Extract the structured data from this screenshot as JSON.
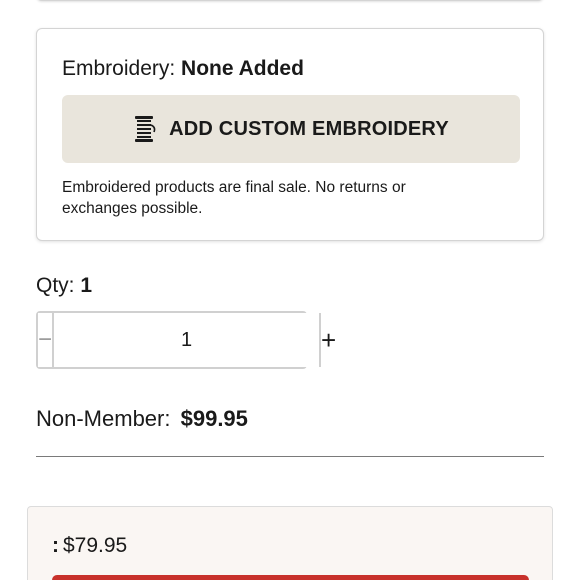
{
  "embroidery": {
    "label": "Embroidery:",
    "value": "None Added",
    "button_label": "ADD CUSTOM EMBROIDERY",
    "button_icon": "thread-spool-icon",
    "note": "Embroidered products are final sale. No returns or exchanges possible."
  },
  "quantity": {
    "label": "Qty:",
    "value": "1",
    "input_value": "1",
    "decrement_symbol": "−",
    "increment_symbol": "+"
  },
  "pricing": {
    "non_member_label": "Non-Member:",
    "non_member_price": "$99.95",
    "member_label": ":",
    "member_price": "$79.95"
  },
  "colors": {
    "button_bg": "#e9e5dc",
    "member_panel_bg": "#faf6f3",
    "cta_red": "#c8312b"
  }
}
